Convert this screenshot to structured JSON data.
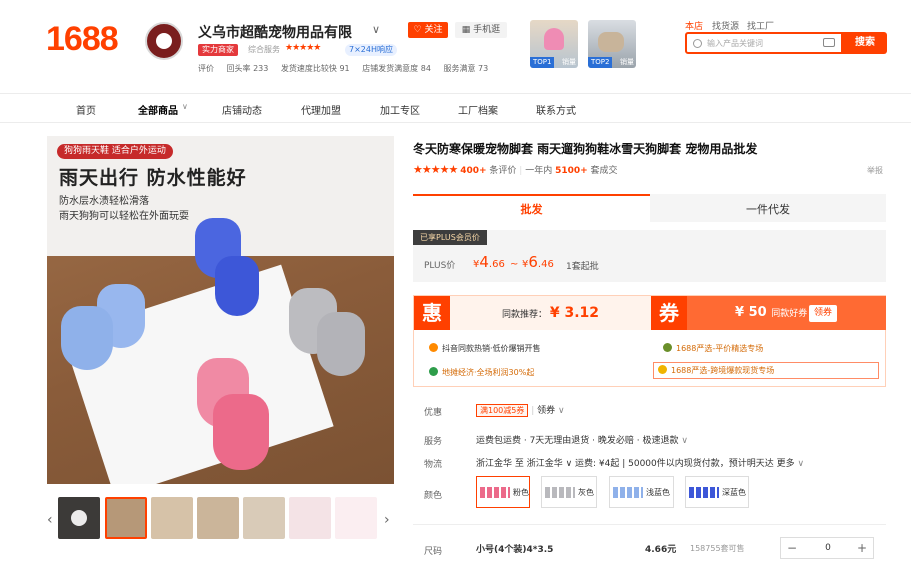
{
  "header": {
    "logo": "1688",
    "shop_name": "义乌市超酷宠物用品有限",
    "follow": "关注",
    "mobile": "手机逛",
    "badge_strong": "实力商家",
    "service_label": "综合服务",
    "response": "7×24H响应",
    "stats": [
      "评价",
      "回头率 233",
      "发货速度比较快 91",
      "店铺发货满意度 84",
      "服务满意 73"
    ],
    "top1": {
      "tag": "TOP1",
      "label": "销量"
    },
    "top2": {
      "tag": "TOP2",
      "label": "销量"
    },
    "scopes": [
      "本店",
      "找货源",
      "找工厂"
    ],
    "search_placeholder": "输入产品关键词",
    "search_button": "搜索"
  },
  "nav": [
    "首页",
    "全部商品",
    "店铺动态",
    "代理加盟",
    "加工专区",
    "工厂档案",
    "联系方式"
  ],
  "image": {
    "pill": "狗狗雨天鞋 适合户外运动",
    "headline": "雨天出行 防水性能好",
    "line1": "防水层水渍轻松滑落",
    "line2": "雨天狗狗可以轻松在外面玩耍"
  },
  "product": {
    "title": "冬天防寒保暖宠物脚套 雨天遛狗狗鞋冰雪天狗脚套 宠物用品批发",
    "rating_count": "400+",
    "rating_suffix": "条评价",
    "sold_prefix": "一年内",
    "sold_count": "5100+",
    "sold_suffix": "套成交",
    "report": "举报"
  },
  "tabs": {
    "wholesale": "批发",
    "dropship": "一件代发"
  },
  "pricing": {
    "plus_tag": "已享PLUS会员价",
    "plus_label": "PLUS价",
    "low_int": "4",
    "low_dec": ".66",
    "high_int": "6",
    "high_dec": ".46",
    "currency": "¥",
    "tilde": "~",
    "moq": "1套起批"
  },
  "promo": {
    "hui": "惠",
    "same_label": "同款推荐",
    "same_price": "¥ 3.12",
    "quan": "券",
    "coupon_amount": "¥ 50",
    "coupon_text": "同款好券",
    "coupon_button": "领券",
    "line1": "抖音同款热销·低价爆销开售",
    "line2": "1688严选-平价精选专场",
    "line3": "地摊经济·全场利润30%起",
    "line4": "1688严选-跨境爆款现货专场"
  },
  "details": {
    "youhui_label": "优惠",
    "youhui_tag": "满100减5券",
    "youhui_get": "领券",
    "service_label": "服务",
    "service_value": "运费包运费 · 7天无理由退货 · 晚发必赔 · 极速退款",
    "logistics_label": "物流",
    "logistics_value": "浙江金华 至 浙江金华 ∨  运费: ¥4起  |  50000件以内现货付款，预计明天达  更多",
    "color_label": "颜色",
    "colors": [
      "粉色",
      "灰色",
      "浅蓝色",
      "深蓝色"
    ],
    "size_label": "尺码",
    "size_name": "小号(4个装)4*3.5",
    "size_price": "4.66元",
    "size_stock": "158755套可售",
    "quantity": "0",
    "minus": "−",
    "plus": "+"
  },
  "colors_hex": {
    "brand": "#ff4000",
    "pink": "#ec6a8a",
    "grey": "#b9b9bd",
    "lightblue": "#8fb1ea",
    "darkblue": "#3d57d8"
  }
}
